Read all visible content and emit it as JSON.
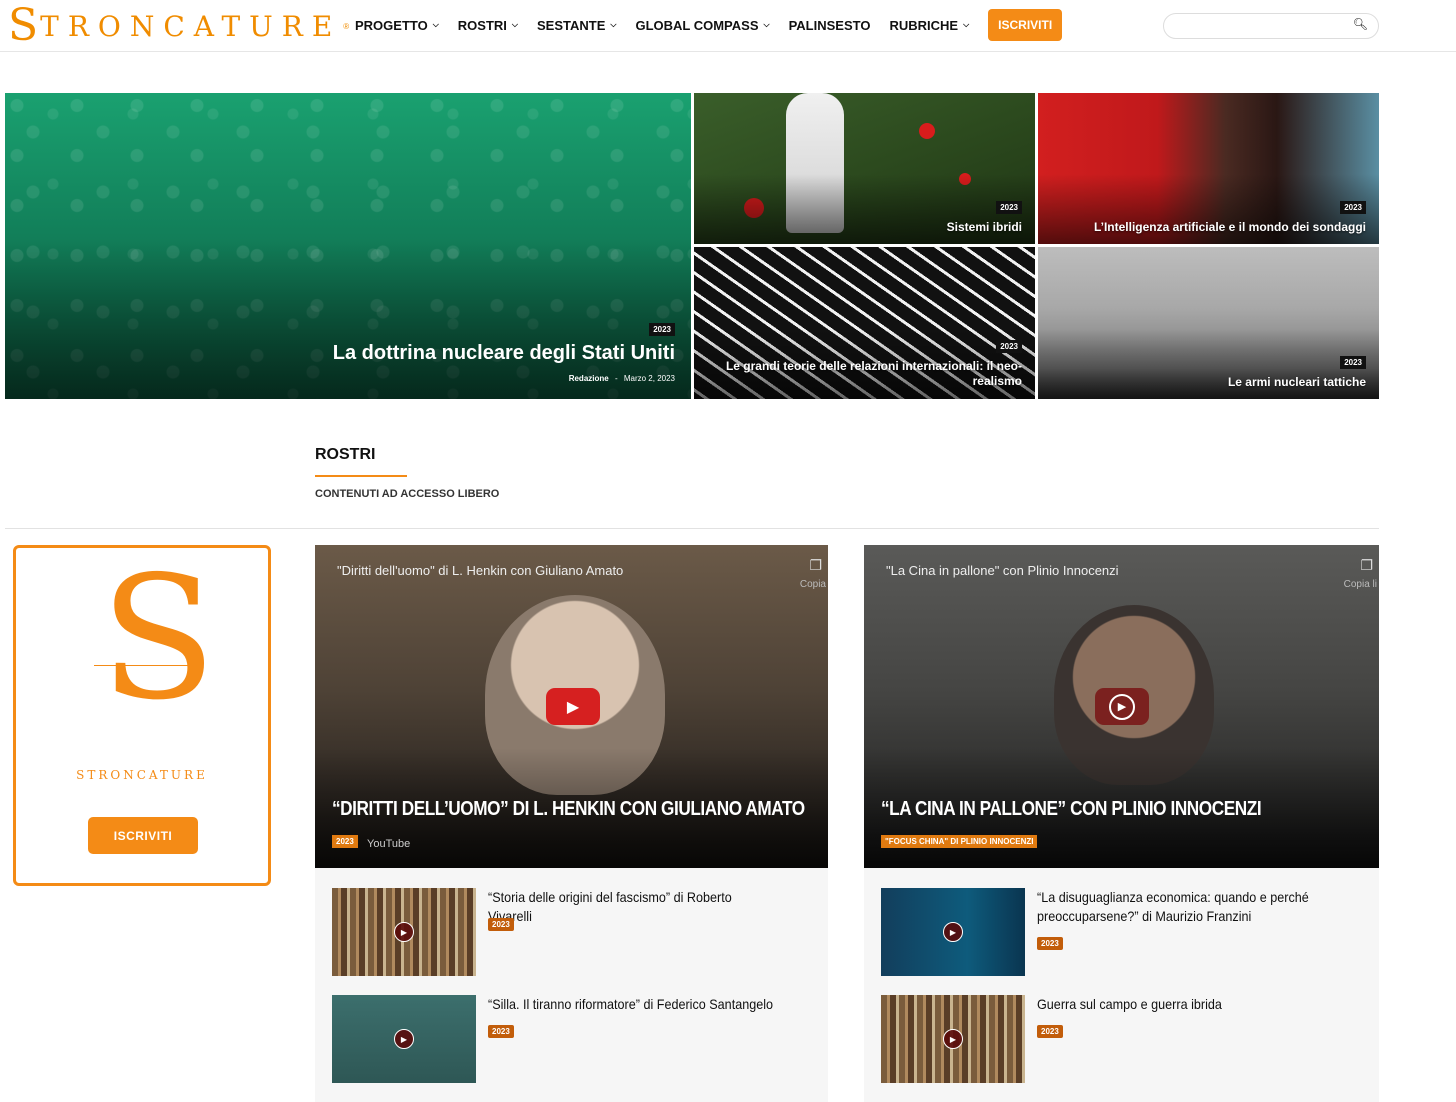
{
  "header": {
    "logo_initial": "S",
    "logo_rest": "TRONCATURE",
    "logo_reg": "®",
    "nav": [
      {
        "label": "PROGETTO",
        "has_dropdown": true
      },
      {
        "label": "ROSTRI",
        "has_dropdown": true
      },
      {
        "label": "SESTANTE",
        "has_dropdown": true
      },
      {
        "label": "GLOBAL COMPASS",
        "has_dropdown": true
      },
      {
        "label": "PALINSESTO",
        "has_dropdown": false
      },
      {
        "label": "RUBRICHE",
        "has_dropdown": true
      }
    ],
    "subscribe_label": "ISCRIVITI",
    "search_placeholder": "",
    "search_icon": "search-icon"
  },
  "hero": {
    "main": {
      "badge": "2023",
      "title": "La dottrina nucleare degli Stati Uniti",
      "author": "Redazione",
      "separator": "-",
      "date": "Marzo 2, 2023"
    },
    "tiles": [
      {
        "badge": "2023",
        "title": "Sistemi ibridi"
      },
      {
        "badge": "2023",
        "title": "L’Intelligenza artificiale e il mondo dei sondaggi"
      },
      {
        "badge": "2023",
        "title": "Le grandi teorie delle relazioni internazionali: il neo-realismo"
      },
      {
        "badge": "2023",
        "title": "Le armi nucleari tattiche"
      }
    ]
  },
  "section": {
    "title": "ROSTRI",
    "subtitle": "CONTENUTI AD ACCESSO LIBERO"
  },
  "promo": {
    "letter": "S",
    "name": "STRONCATURE",
    "button": "ISCRIVITI"
  },
  "videos": [
    {
      "caption": "\"Diritti dell'uomo\" di L. Henkin con Giuliano Amato",
      "copy_label": "Copia",
      "title": "“Diritti dell’uomo” di L. Henkin con Giuliano Amato",
      "badge": "2023",
      "yt_logo": "YouTube",
      "list": [
        {
          "title": "“Storia delle origini del fascismo” di Roberto Vivarelli",
          "badge": "2023"
        },
        {
          "title": "“Silla. Il tiranno riformatore” di Federico Santangelo",
          "badge": "2023"
        }
      ]
    },
    {
      "caption": "\"La Cina in pallone\" con Plinio Innocenzi",
      "copy_label": "Copia li",
      "title": "“La Cina in pallone” con Plinio Innocenzi",
      "badge": "\"FOCUS CHINA\" DI PLINIO INNOCENZI",
      "list": [
        {
          "title": "“La disuguaglianza economica: quando e perché preoccuparsene?” di Maurizio Franzini",
          "badge": "2023"
        },
        {
          "title": "Guerra sul campo e guerra ibrida",
          "badge": "2023"
        }
      ]
    }
  ],
  "colors": {
    "accent": "#f48b16",
    "badge_orange": "#c25d0a",
    "play_red": "#d62020"
  }
}
